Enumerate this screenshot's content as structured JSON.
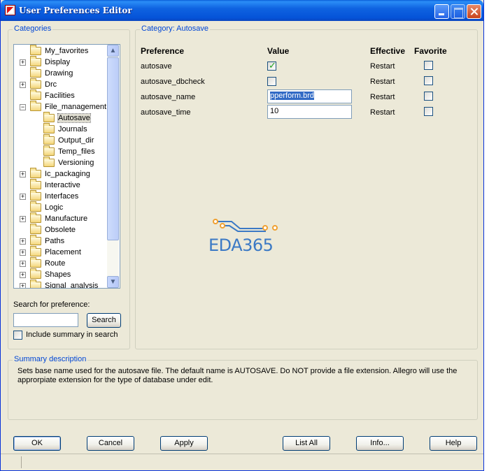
{
  "window": {
    "title": "User Preferences Editor"
  },
  "categories": {
    "legend": "Categories",
    "tree": [
      {
        "label": "My_favorites",
        "level": 0,
        "expander": ""
      },
      {
        "label": "Display",
        "level": 0,
        "expander": "+"
      },
      {
        "label": "Drawing",
        "level": 0,
        "expander": ""
      },
      {
        "label": "Drc",
        "level": 0,
        "expander": "+"
      },
      {
        "label": "Facilities",
        "level": 0,
        "expander": ""
      },
      {
        "label": "File_management",
        "level": 0,
        "expander": "−"
      },
      {
        "label": "Autosave",
        "level": 1,
        "expander": "",
        "selected": true
      },
      {
        "label": "Journals",
        "level": 1,
        "expander": ""
      },
      {
        "label": "Output_dir",
        "level": 1,
        "expander": ""
      },
      {
        "label": "Temp_files",
        "level": 1,
        "expander": ""
      },
      {
        "label": "Versioning",
        "level": 1,
        "expander": ""
      },
      {
        "label": "Ic_packaging",
        "level": 0,
        "expander": "+"
      },
      {
        "label": "Interactive",
        "level": 0,
        "expander": ""
      },
      {
        "label": "Interfaces",
        "level": 0,
        "expander": "+"
      },
      {
        "label": "Logic",
        "level": 0,
        "expander": ""
      },
      {
        "label": "Manufacture",
        "level": 0,
        "expander": "+"
      },
      {
        "label": "Obsolete",
        "level": 0,
        "expander": ""
      },
      {
        "label": "Paths",
        "level": 0,
        "expander": "+"
      },
      {
        "label": "Placement",
        "level": 0,
        "expander": "+"
      },
      {
        "label": "Route",
        "level": 0,
        "expander": "+"
      },
      {
        "label": "Shapes",
        "level": 0,
        "expander": "+"
      },
      {
        "label": "Signal_analysis",
        "level": 0,
        "expander": "+"
      }
    ],
    "search_label": "Search for preference:",
    "search_value": "",
    "search_button": "Search",
    "include_summary": "Include summary in search",
    "include_summary_checked": false
  },
  "category_panel": {
    "legend": "Category:  Autosave",
    "headers": {
      "preference": "Preference",
      "value": "Value",
      "effective": "Effective",
      "favorite": "Favorite"
    },
    "rows": [
      {
        "name": "autosave",
        "value_type": "checkbox",
        "checked": true,
        "effective": "Restart",
        "favorite": false
      },
      {
        "name": "autosave_dbcheck",
        "value_type": "checkbox",
        "checked": false,
        "effective": "Restart",
        "favorite": false
      },
      {
        "name": "autosave_name",
        "value_type": "text",
        "value": "pperform.brd",
        "effective": "Restart",
        "favorite": false
      },
      {
        "name": "autosave_time",
        "value_type": "text",
        "value": "10",
        "effective": "Restart",
        "favorite": false
      }
    ],
    "logo_text": "EDA365"
  },
  "summary": {
    "legend": "Summary description",
    "text": "Sets base name used for the autosave file. The default name is AUTOSAVE. Do NOT provide a file extension. Allegro will use the approrpiate extension for the type of database under edit."
  },
  "buttons": {
    "ok": "OK",
    "cancel": "Cancel",
    "apply": "Apply",
    "list_all": "List All",
    "info": "Info...",
    "help": "Help"
  },
  "colors": {
    "accent": "#0046d5",
    "titlebar": "#0553d8",
    "selection": "#316ac5"
  }
}
